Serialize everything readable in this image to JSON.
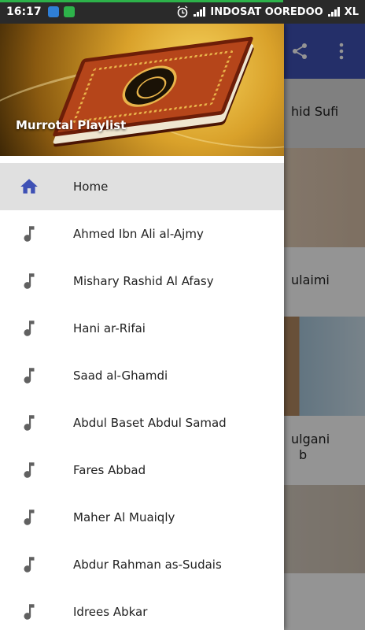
{
  "status_bar": {
    "time": "16:17",
    "carrier": "INDOSAT OOREDOO",
    "network": "XL",
    "icons": [
      "cloud-app-icon",
      "message-app-icon",
      "alarm-icon",
      "signal-icon"
    ]
  },
  "drawer": {
    "header_title": "Murrotal Playlist",
    "items": [
      {
        "label": "Home",
        "icon": "home-icon",
        "active": true
      },
      {
        "label": "Ahmed Ibn Ali al-Ajmy",
        "icon": "music-note-icon"
      },
      {
        "label": "Mishary Rashid Al Afasy",
        "icon": "music-note-icon"
      },
      {
        "label": "Hani ar-Rifai",
        "icon": "music-note-icon"
      },
      {
        "label": "Saad al-Ghamdi",
        "icon": "music-note-icon"
      },
      {
        "label": "Abdul Baset Abdul Samad",
        "icon": "music-note-icon"
      },
      {
        "label": "Fares Abbad",
        "icon": "music-note-icon"
      },
      {
        "label": "Maher Al Muaiqly",
        "icon": "music-note-icon"
      },
      {
        "label": "Abdur Rahman as-Sudais",
        "icon": "music-note-icon"
      },
      {
        "label": "Idrees Abkar",
        "icon": "music-note-icon"
      }
    ]
  },
  "background": {
    "toolbar_icons": [
      "share-icon",
      "overflow-menu-icon"
    ],
    "list_fragments": [
      "hid Sufi",
      "ulaimi",
      "ulgani",
      "b"
    ]
  },
  "colors": {
    "primary": "#3f51b5",
    "active_item_bg": "#e0e0e0",
    "icon_active": "#3f51b5",
    "icon_inactive": "#616161"
  }
}
